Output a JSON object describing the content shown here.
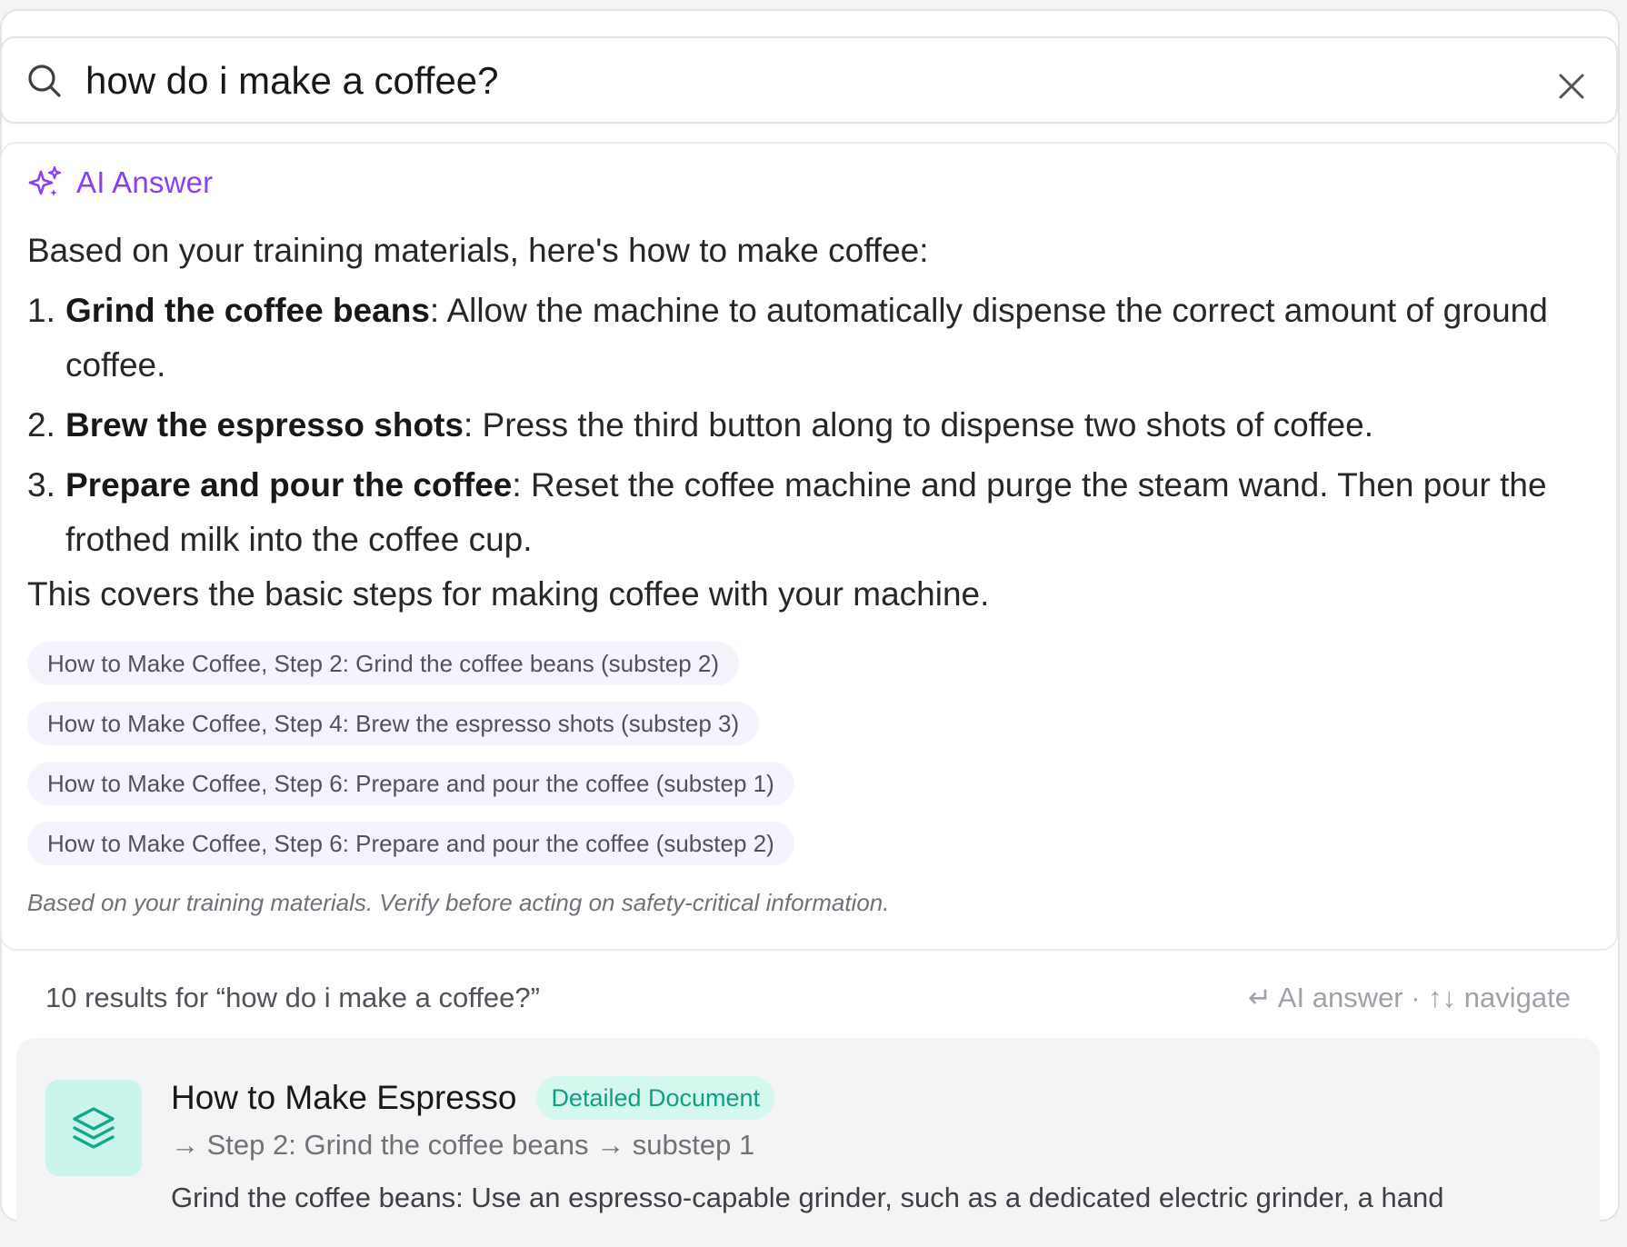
{
  "search": {
    "value": "how do i make a coffee?",
    "placeholder": ""
  },
  "ai_answer": {
    "title": "AI Answer",
    "intro": "Based on your training materials, here's how to make coffee:",
    "steps": [
      {
        "num": "1.",
        "bold": "Grind the coffee beans",
        "text": ": Allow the machine to automatically dispense the correct amount of ground coffee."
      },
      {
        "num": "2.",
        "bold": "Brew the espresso shots",
        "text": ": Press the third button along to dispense two shots of coffee."
      },
      {
        "num": "3.",
        "bold": "Prepare and pour the coffee",
        "text": ": Reset the coffee machine and purge the steam wand. Then pour the frothed milk into the coffee cup."
      }
    ],
    "outro": "This covers the basic steps for making coffee with your machine.",
    "sources": [
      "How to Make Coffee, Step 2: Grind the coffee beans (substep 2)",
      "How to Make Coffee, Step 4: Brew the espresso shots (substep 3)",
      "How to Make Coffee, Step 6: Prepare and pour the coffee (substep 1)",
      "How to Make Coffee, Step 6: Prepare and pour the coffee (substep 2)"
    ],
    "disclaimer": "Based on your training materials. Verify before acting on safety-critical information."
  },
  "results": {
    "summary": "10 results for “how do i make a coffee?”",
    "hints": "↵ AI answer · ↑↓ navigate",
    "items": [
      {
        "title": "How to Make Espresso",
        "badge": "Detailed Document",
        "path": "→ Step 2: Grind the coffee beans → substep 1",
        "snippet": "Grind the coffee beans: Use an espresso-capable grinder, such as a dedicated electric grinder, a hand"
      }
    ]
  },
  "colors": {
    "accent_purple": "#8b3ef2",
    "badge_teal": "#0f9f84",
    "icon_box_teal": "#cbf5ec",
    "chip_bg": "#f5f3fb"
  },
  "icons": {
    "search": "search-icon",
    "close": "close-icon",
    "ai": "sparkle-icon",
    "document": "layers-icon"
  }
}
